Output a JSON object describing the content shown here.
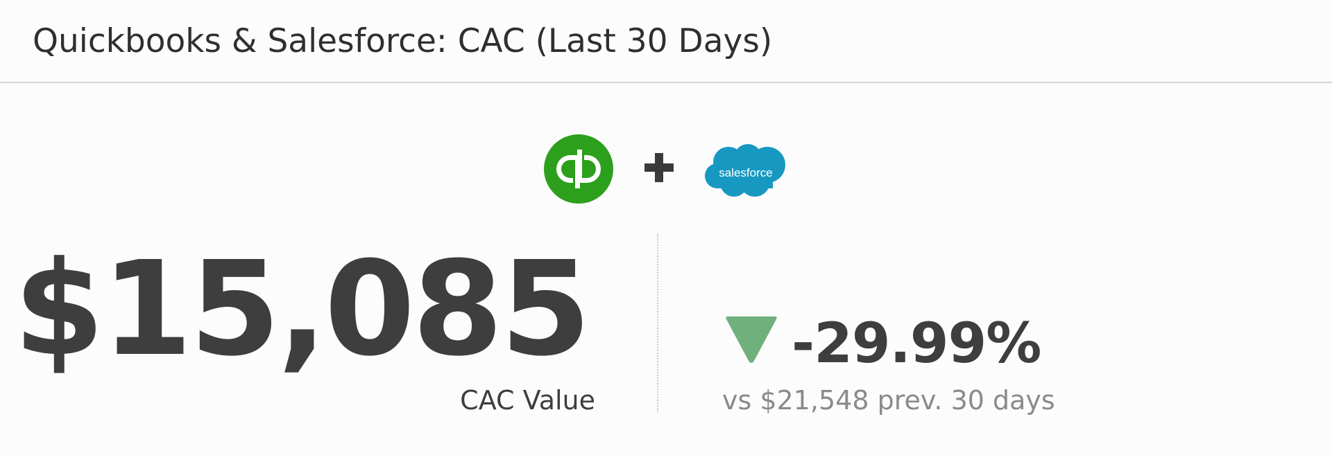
{
  "widget": {
    "title": "Quickbooks & Salesforce: CAC (Last 30 Days)"
  },
  "logos": {
    "left": "quickbooks-logo",
    "separator": "plus-icon",
    "right": "salesforce-logo",
    "salesforce_text": "salesforce"
  },
  "metric": {
    "value": "$15,085",
    "label": "CAC Value"
  },
  "change": {
    "direction": "down",
    "value": "-29.99%",
    "comparison": "vs $21,548 prev. 30 days"
  },
  "colors": {
    "quickbooks_green": "#2ca01c",
    "salesforce_blue": "#1798c1",
    "trend_down_green": "#6fb07d",
    "text_dark": "#3e3e3e",
    "text_muted": "#8a8a8a"
  }
}
